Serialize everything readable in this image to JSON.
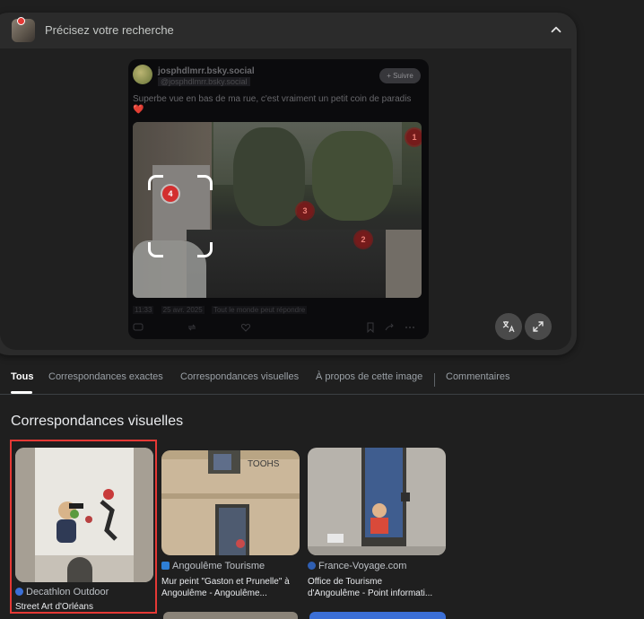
{
  "refine": {
    "title": "Précisez votre recherche"
  },
  "post": {
    "handle": "josphdlmrr.bsky.social",
    "handle_sub": "@josphdlmrr.bsky.social",
    "follow_label": "+ Suivre",
    "text": "Superbe vue en bas de ma rue, c'est vraiment un petit coin de paradis",
    "heart": "❤️",
    "time": "11:33",
    "date": "25 avr. 2025",
    "reply_setting": "Tout le monde peut répondre",
    "markers": [
      "1",
      "2",
      "3",
      "4"
    ]
  },
  "tabs": [
    "Tous",
    "Correspondances exactes",
    "Correspondances visuelles",
    "À propos de cette image",
    "Commentaires"
  ],
  "section_title": "Correspondances visuelles",
  "results": [
    {
      "source": "Decathlon Outdoor",
      "title_lines": [
        "Street Art d'Orléans"
      ]
    },
    {
      "source": "Angoulême Tourisme",
      "title_lines": [
        "Mur peint \"Gaston et Prunelle\" à",
        "Angoulême - Angoulême..."
      ]
    },
    {
      "source": "France-Voyage.com",
      "title_lines": [
        "Office de Tourisme",
        "d'Angoulême - Point informati..."
      ]
    }
  ],
  "colors": {
    "background": "#1f1f1f",
    "panel": "#2b2b2b",
    "selection": "#e53935",
    "marker": "#d32f2f"
  },
  "icons": [
    "chevron-up-icon",
    "translate-icon",
    "expand-icon",
    "reply-icon",
    "repost-icon",
    "like-icon",
    "bookmark-icon",
    "share-icon",
    "more-icon"
  ]
}
